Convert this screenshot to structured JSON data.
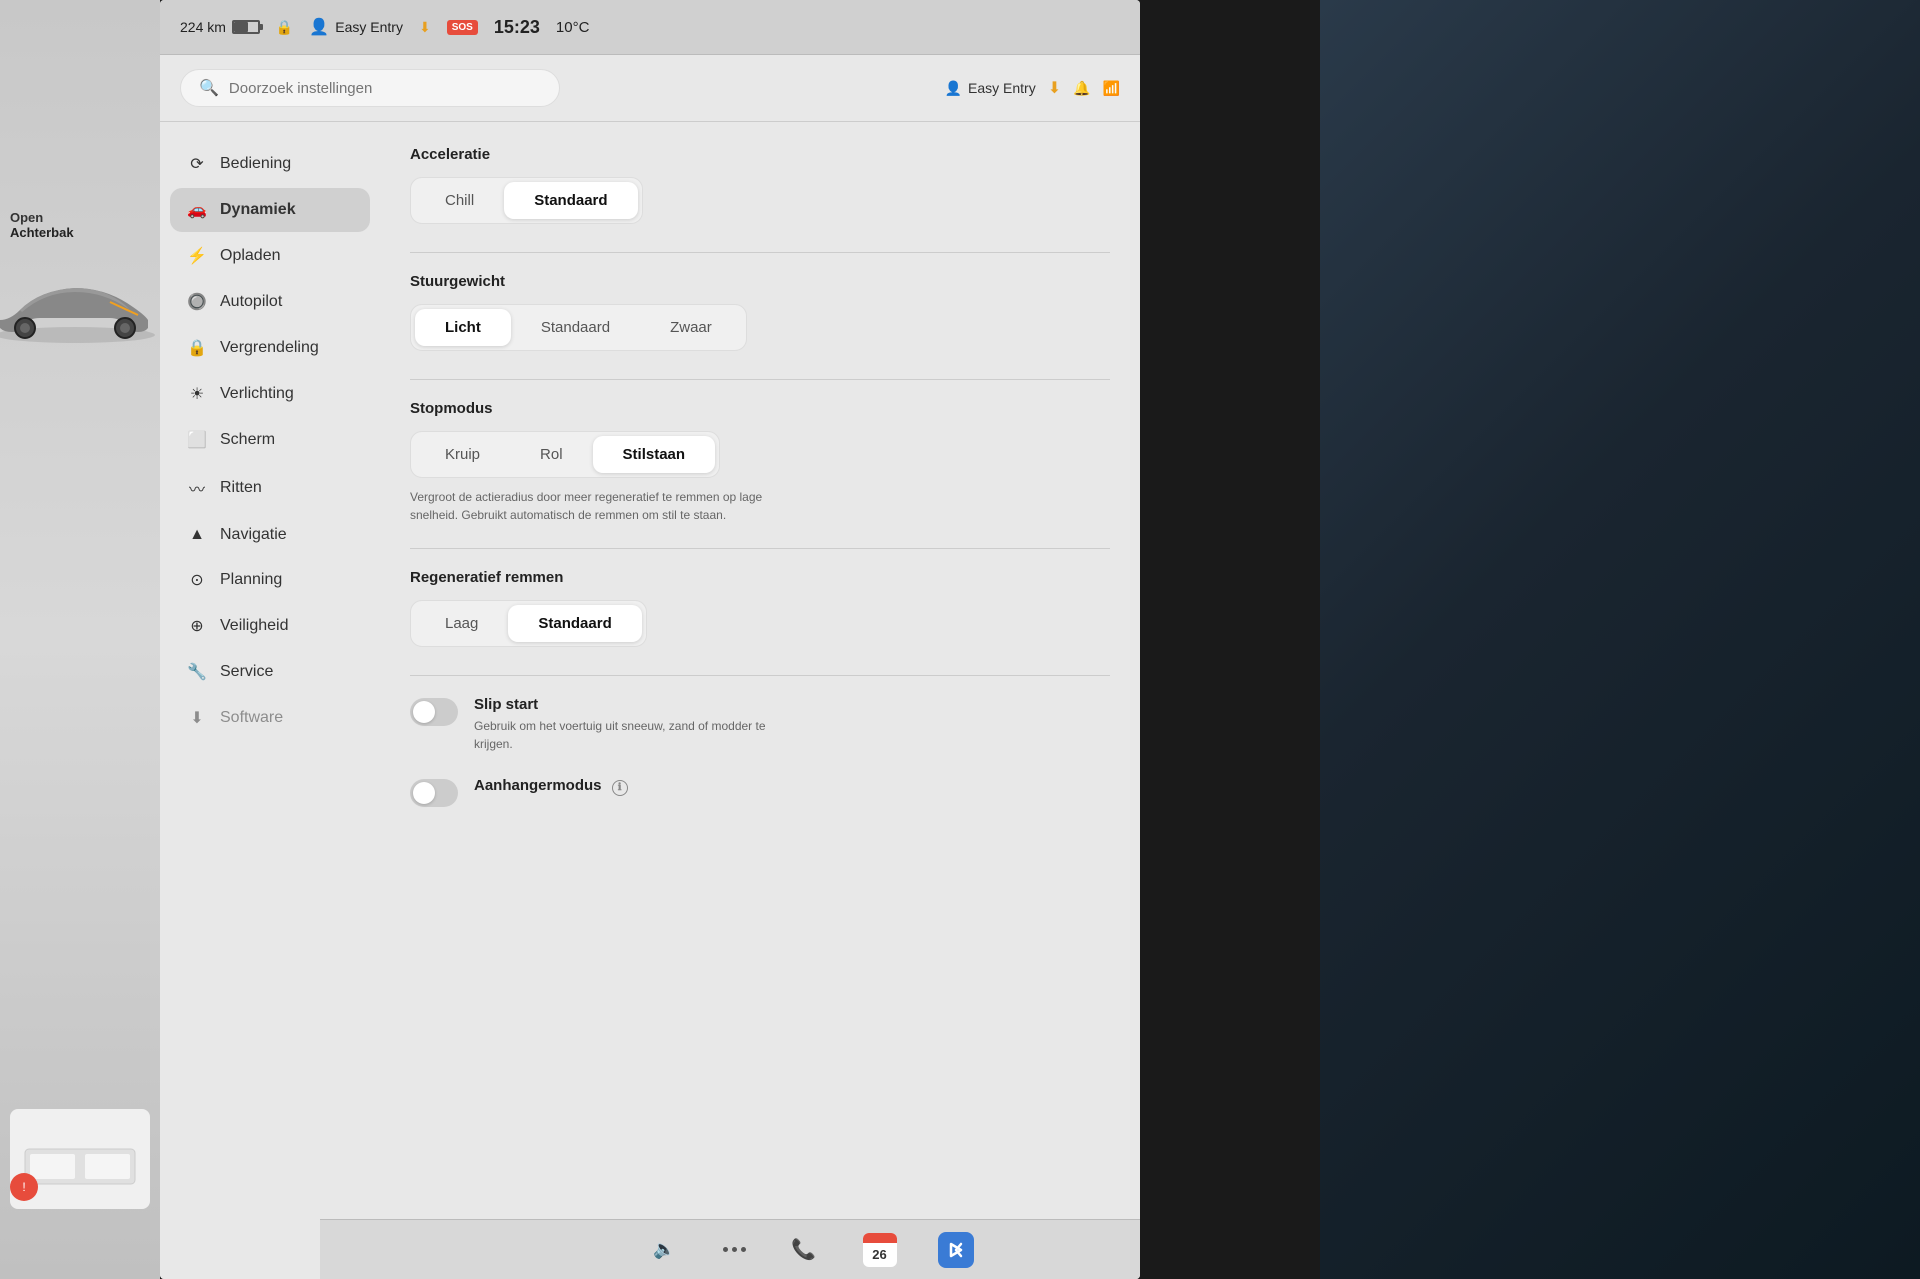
{
  "statusBar": {
    "distance": "224 km",
    "lock_icon": "🔒",
    "person_icon": "👤",
    "profile_name": "Easy Entry",
    "sos_label": "SOS",
    "download_icon": "⬇",
    "time": "15:23",
    "temperature": "10°C"
  },
  "header": {
    "search_placeholder": "Doorzoek instellingen",
    "profile_label": "Easy Entry",
    "download_icon": "⬇"
  },
  "sidebar": {
    "items": [
      {
        "id": "bediening",
        "label": "Bediening",
        "icon": "⟳"
      },
      {
        "id": "dynamiek",
        "label": "Dynamiek",
        "icon": "🚗",
        "active": true
      },
      {
        "id": "opladen",
        "label": "Opladen",
        "icon": "⚡"
      },
      {
        "id": "autopilot",
        "label": "Autopilot",
        "icon": "🔘"
      },
      {
        "id": "vergrendeling",
        "label": "Vergrendeling",
        "icon": "🔒"
      },
      {
        "id": "verlichting",
        "label": "Verlichting",
        "icon": "☀"
      },
      {
        "id": "scherm",
        "label": "Scherm",
        "icon": "⬜"
      },
      {
        "id": "ritten",
        "label": "Ritten",
        "icon": "〰"
      },
      {
        "id": "navigatie",
        "label": "Navigatie",
        "icon": "▲"
      },
      {
        "id": "planning",
        "label": "Planning",
        "icon": "⊙"
      },
      {
        "id": "veiligheid",
        "label": "Veiligheid",
        "icon": "⊕"
      },
      {
        "id": "service",
        "label": "Service",
        "icon": "🔧"
      },
      {
        "id": "software",
        "label": "Software",
        "icon": "⬇"
      }
    ]
  },
  "settings": {
    "acceleratie": {
      "title": "Acceleratie",
      "options": [
        {
          "id": "chill",
          "label": "Chill",
          "active": false
        },
        {
          "id": "standaard",
          "label": "Standaard",
          "active": true
        }
      ]
    },
    "stuurgewicht": {
      "title": "Stuurgewicht",
      "options": [
        {
          "id": "licht",
          "label": "Licht",
          "active": true
        },
        {
          "id": "standaard",
          "label": "Standaard",
          "active": false
        },
        {
          "id": "zwaar",
          "label": "Zwaar",
          "active": false
        }
      ]
    },
    "stopmodus": {
      "title": "Stopmodus",
      "options": [
        {
          "id": "kruip",
          "label": "Kruip",
          "active": false
        },
        {
          "id": "rol",
          "label": "Rol",
          "active": false
        },
        {
          "id": "stilstaan",
          "label": "Stilstaan",
          "active": true
        }
      ],
      "description": "Vergroot de actieradius door meer regeneratief te remmen op lage snelheid. Gebruikt automatisch de remmen om stil te staan."
    },
    "regeneratief_remmen": {
      "title": "Regeneratief remmen",
      "options": [
        {
          "id": "laag",
          "label": "Laag",
          "active": false
        },
        {
          "id": "standaard",
          "label": "Standaard",
          "active": true
        }
      ]
    },
    "slip_start": {
      "title": "Slip start",
      "description": "Gebruik om het voertuig uit sneeuw, zand of modder te krijgen.",
      "enabled": false
    },
    "aanhangermodus": {
      "title": "Aanhangermodus",
      "info_icon": "ℹ",
      "enabled": false
    }
  },
  "taskbar": {
    "speaker_icon": "🔈",
    "dots_label": "•••",
    "bluetooth_label": "B",
    "phone_label": "📞",
    "calendar_date": "26"
  },
  "leftPanel": {
    "open_label": "Open",
    "achterbak_label": "Achterbak"
  }
}
